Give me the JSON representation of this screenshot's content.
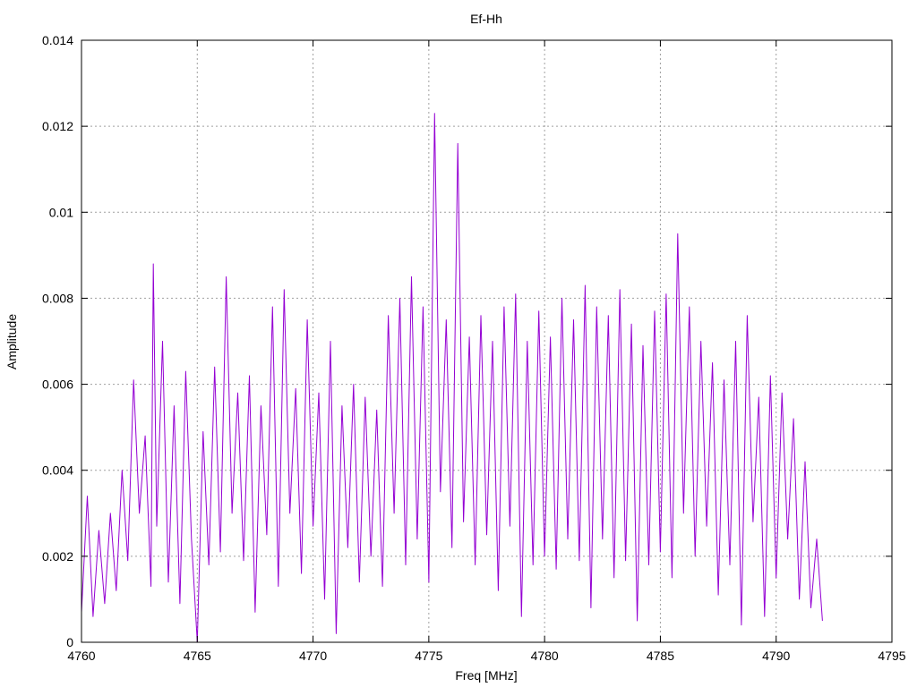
{
  "chart_data": {
    "type": "line",
    "title": "Ef-Hh",
    "xlabel": "Freq [MHz]",
    "ylabel": "Amplitude",
    "xlim": [
      4760,
      4795
    ],
    "ylim": [
      0,
      0.014
    ],
    "xticks": [
      4760,
      4765,
      4770,
      4775,
      4780,
      4785,
      4790,
      4795
    ],
    "xtick_labels": [
      "4760",
      "4765",
      "4770",
      "4775",
      "4780",
      "4785",
      "4790",
      "4795"
    ],
    "yticks": [
      0,
      0.002,
      0.004,
      0.006,
      0.008,
      0.01,
      0.012,
      0.014
    ],
    "ytick_labels": [
      "0",
      "0.002",
      "0.004",
      "0.006",
      "0.008",
      "0.01",
      "0.012",
      "0.014"
    ],
    "grid": true,
    "legend": "none",
    "series": [
      {
        "color": "#9400d3",
        "x": [
          4760.0,
          4760.25,
          4760.5,
          4760.75,
          4761.0,
          4761.25,
          4761.5,
          4761.75,
          4762.0,
          4762.25,
          4762.5,
          4762.75,
          4763.0,
          4763.1,
          4763.25,
          4763.5,
          4763.75,
          4764.0,
          4764.25,
          4764.5,
          4764.75,
          4765.0,
          4765.25,
          4765.5,
          4765.75,
          4766.0,
          4766.25,
          4766.5,
          4766.75,
          4767.0,
          4767.25,
          4767.5,
          4767.75,
          4768.0,
          4768.25,
          4768.5,
          4768.75,
          4769.0,
          4769.25,
          4769.5,
          4769.75,
          4770.0,
          4770.25,
          4770.5,
          4770.75,
          4771.0,
          4771.25,
          4771.5,
          4771.75,
          4772.0,
          4772.25,
          4772.5,
          4772.75,
          4773.0,
          4773.25,
          4773.5,
          4773.75,
          4774.0,
          4774.25,
          4774.5,
          4774.75,
          4775.0,
          4775.25,
          4775.5,
          4775.75,
          4776.0,
          4776.25,
          4776.5,
          4776.75,
          4777.0,
          4777.25,
          4777.5,
          4777.75,
          4778.0,
          4778.25,
          4778.5,
          4778.75,
          4779.0,
          4779.25,
          4779.5,
          4779.75,
          4780.0,
          4780.25,
          4780.5,
          4780.75,
          4781.0,
          4781.25,
          4781.5,
          4781.75,
          4782.0,
          4782.25,
          4782.5,
          4782.75,
          4783.0,
          4783.25,
          4783.5,
          4783.75,
          4784.0,
          4784.25,
          4784.5,
          4784.75,
          4785.0,
          4785.25,
          4785.5,
          4785.75,
          4786.0,
          4786.25,
          4786.5,
          4786.75,
          4787.0,
          4787.25,
          4787.5,
          4787.75,
          4788.0,
          4788.25,
          4788.5,
          4788.75,
          4789.0,
          4789.25,
          4789.5,
          4789.75,
          4790.0,
          4790.25,
          4790.5,
          4790.75,
          4791.0,
          4791.25,
          4791.5,
          4791.75,
          4792.0
        ],
        "y": [
          0.0007,
          0.0034,
          0.0006,
          0.0026,
          0.0009,
          0.003,
          0.0012,
          0.004,
          0.0019,
          0.0061,
          0.003,
          0.0048,
          0.0013,
          0.0088,
          0.0027,
          0.007,
          0.0014,
          0.0055,
          0.0009,
          0.0063,
          0.0024,
          0.0,
          0.0049,
          0.0018,
          0.0064,
          0.0021,
          0.0085,
          0.003,
          0.0058,
          0.0019,
          0.0062,
          0.0007,
          0.0055,
          0.0025,
          0.0078,
          0.0013,
          0.0082,
          0.003,
          0.0059,
          0.0016,
          0.0075,
          0.0027,
          0.0058,
          0.001,
          0.007,
          0.0002,
          0.0055,
          0.0022,
          0.006,
          0.0014,
          0.0057,
          0.002,
          0.0054,
          0.0013,
          0.0076,
          0.003,
          0.008,
          0.0018,
          0.0085,
          0.0024,
          0.0078,
          0.0014,
          0.0123,
          0.0035,
          0.0075,
          0.0022,
          0.0116,
          0.0028,
          0.0071,
          0.0018,
          0.0076,
          0.0025,
          0.007,
          0.0012,
          0.0078,
          0.0027,
          0.0081,
          0.0006,
          0.007,
          0.0018,
          0.0077,
          0.002,
          0.0071,
          0.0017,
          0.008,
          0.0024,
          0.0075,
          0.0019,
          0.0083,
          0.0008,
          0.0078,
          0.0024,
          0.0076,
          0.0015,
          0.0082,
          0.0019,
          0.0074,
          0.0005,
          0.0069,
          0.0018,
          0.0077,
          0.0021,
          0.0081,
          0.0015,
          0.0095,
          0.003,
          0.0078,
          0.002,
          0.007,
          0.0027,
          0.0065,
          0.0011,
          0.0061,
          0.0018,
          0.007,
          0.0004,
          0.0076,
          0.0028,
          0.0057,
          0.0006,
          0.0062,
          0.0015,
          0.0058,
          0.0024,
          0.0052,
          0.001,
          0.0042,
          0.0008,
          0.0024,
          0.0005
        ]
      }
    ]
  }
}
